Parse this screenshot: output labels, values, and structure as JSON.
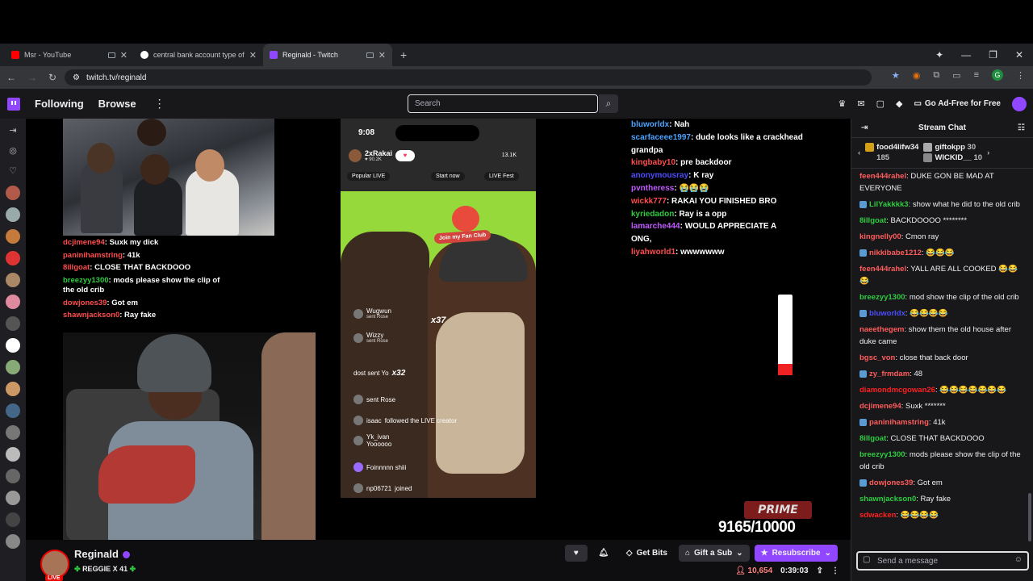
{
  "browser": {
    "tabs": [
      {
        "title": "Msr - YouTube",
        "color": "#ff0000",
        "active": false
      },
      {
        "title": "central bank account type of u:",
        "color": "#4285f4",
        "active": false
      },
      {
        "title": "Reginald - Twitch",
        "color": "#9146ff",
        "active": true
      }
    ],
    "url": "twitch.tv/reginald",
    "new_tab_glyph": "+",
    "profile_letter": "G"
  },
  "twitch_nav": {
    "following": "Following",
    "browse": "Browse",
    "search_placeholder": "Search",
    "ad_free": "Go Ad-Free for Free"
  },
  "stream_overlay_chat": [
    {
      "user": "dcjimene94",
      "color": "#ff4d4d",
      "text": "Suxk my dick"
    },
    {
      "user": "paninihamstring",
      "color": "#ff4d4d",
      "text": "41k"
    },
    {
      "user": "8illgoat",
      "color": "#ff4d4d",
      "text": "CLOSE THAT BACKDOOO"
    },
    {
      "user": "breezyy1300",
      "color": "#2ecc40",
      "text": "mods please show the clip of the old crib"
    },
    {
      "user": "dowjones39",
      "color": "#ff4d4d",
      "text": "Got em"
    },
    {
      "user": "shawnjackson0",
      "color": "#ff4d4d",
      "text": "Ray fake"
    }
  ],
  "phone": {
    "time": "9:08",
    "host": "2xRakai",
    "host_likes": "90.2K",
    "viewers": "13.1K",
    "chip_popular": "Popular LIVE",
    "chip_start": "Start now",
    "chip_fest": "LIVE Fest",
    "fan_club": "Join my Fan Club",
    "gift_multiplier_1": "x37",
    "gift_multiplier_2": "x32",
    "comments": [
      {
        "user": "Wugwun",
        "text": "sent Rose"
      },
      {
        "user": "Wizzy",
        "text": "sent Rose"
      },
      {
        "user": "dost sent Yo",
        "text": ""
      },
      {
        "user": "",
        "text": "sent Rose"
      },
      {
        "user": "isaac",
        "text": "followed the LIVE creator"
      },
      {
        "user": "Yk_ivan",
        "text": "Yoooooo"
      },
      {
        "user": "Foinnnnn shiii",
        "text": ""
      },
      {
        "user": "np06721",
        "text": "joined"
      }
    ],
    "badge_count": "22"
  },
  "stream_right_chat": [
    {
      "user": "bluworldx",
      "color": "#4da3ff",
      "text": "Nah"
    },
    {
      "user": "scarfaceee1997",
      "color": "#4da3ff",
      "text": "dude looks like a crackhead grandpa"
    },
    {
      "user": "kingbaby10",
      "color": "#ff4d4d",
      "text": "pre backdoor"
    },
    {
      "user": "anonymousray",
      "color": "#4d4dff",
      "text": "K ray"
    },
    {
      "user": "pvntheress",
      "color": "#c05bff",
      "text": "😭😭😭"
    },
    {
      "user": "wickk777",
      "color": "#ff4d4d",
      "text": "RAKAI YOU FINISHED BRO"
    },
    {
      "user": "kyriedadon",
      "color": "#2ecc40",
      "text": "Ray is a opp"
    },
    {
      "user": "lamarche444",
      "color": "#c05bff",
      "text": "WOULD APPRECIATE A"
    },
    {
      "user": "",
      "color": "#fff",
      "text": "ONG,"
    },
    {
      "user": "liyahworld1",
      "color": "#ff4d4d",
      "text": "wwwwwww"
    }
  ],
  "prime": {
    "label": "PRIME",
    "goal": "9165/10000"
  },
  "channel": {
    "name": "Reginald",
    "title": "REGGIE X 41",
    "live": "LIVE",
    "viewers": "10,654",
    "uptime": "0:39:03",
    "get_bits": "Get Bits",
    "gift_sub": "Gift a Sub",
    "resubscribe": "Resubscribe"
  },
  "chat": {
    "header": "Stream Chat",
    "gifters": [
      {
        "name": "food4lifw34",
        "count": "185"
      },
      {
        "name": "giftokpp",
        "count": "30"
      },
      {
        "name": "WICKID__",
        "count": "10"
      }
    ],
    "messages": [
      {
        "user": "feen444rahel",
        "color": "#ff5c5c",
        "text": "DUKE GON BE MAD AT EVERYONE"
      },
      {
        "user": "LilYakkkk3",
        "color": "#2ecc40",
        "text": "show what he did to the old crib"
      },
      {
        "user": "8illgoat",
        "color": "#2ecc40",
        "text": "BACKDOOOO ********"
      },
      {
        "user": "kingnelly00",
        "color": "#ff5c5c",
        "text": "Cmon ray"
      },
      {
        "user": "nikkibabe1212",
        "color": "#ff5c5c",
        "text": "😂😂😂"
      },
      {
        "user": "feen444rahel",
        "color": "#ff5c5c",
        "text": "YALL ARE ALL COOKED 😂😂😂"
      },
      {
        "user": "breezyy1300",
        "color": "#2ecc40",
        "text": "mod show the clip of the old crib"
      },
      {
        "user": "bluworldx",
        "color": "#4d4dff",
        "text": "😂😂😂😂"
      },
      {
        "user": "naeethegem",
        "color": "#ff5c5c",
        "text": "show them the old house after duke came"
      },
      {
        "user": "bgsc_von",
        "color": "#ff5c5c",
        "text": "close that back door"
      },
      {
        "user": "zy_frmdam",
        "color": "#ff5c5c",
        "text": "48"
      },
      {
        "user": "diamondmcgowan26",
        "color": "#ff2020",
        "text": "😂😂😂😂😂😂😂"
      },
      {
        "user": "dcjimene94",
        "color": "#ff5c5c",
        "text": "Suxk *******"
      },
      {
        "user": "paninihamstring",
        "color": "#ff5c5c",
        "text": "41k"
      },
      {
        "user": "8illgoat",
        "color": "#2ecc40",
        "text": "CLOSE THAT BACKDOOO"
      },
      {
        "user": "breezyy1300",
        "color": "#2ecc40",
        "text": "mods please show the clip of the old crib"
      },
      {
        "user": "dowjones39",
        "color": "#ff5c5c",
        "text": "Got em"
      },
      {
        "user": "shawnjackson0",
        "color": "#2ecc40",
        "text": "Ray fake"
      },
      {
        "user": "sdwacken",
        "color": "#ff2020",
        "text": "😂😂😂😂"
      }
    ],
    "input_placeholder": "Send a message"
  }
}
